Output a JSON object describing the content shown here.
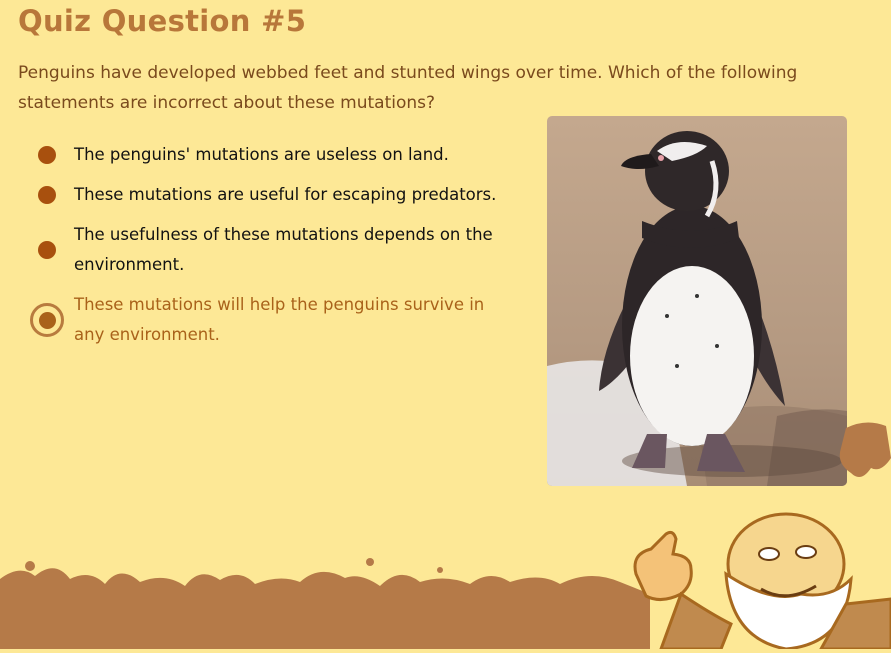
{
  "quiz": {
    "title": "Quiz Question #5",
    "question": "Penguins have developed webbed feet and stunted wings over time. Which of the following statements are incorrect about these mutations?",
    "options": [
      {
        "label": "The penguins' mutations are useless on land.",
        "selected": false
      },
      {
        "label": "These mutations are useful for escaping predators.",
        "selected": false
      },
      {
        "label": "The usefulness of these mutations depends on the environment.",
        "selected": false
      },
      {
        "label": "These mutations will help the penguins survive in any environment.",
        "selected": true
      }
    ]
  },
  "colors": {
    "background": "#fde896",
    "title": "#b8773a",
    "bullet": "#a8500e",
    "selected_text": "#a9621a",
    "ground": "#b57a48"
  },
  "icons": {
    "option_bullet": "filled-circle-bullet",
    "selected_bullet": "radio-selected-icon"
  },
  "images": {
    "photo": "penguin-photo",
    "mascot": "bearded-professor-mascot"
  }
}
